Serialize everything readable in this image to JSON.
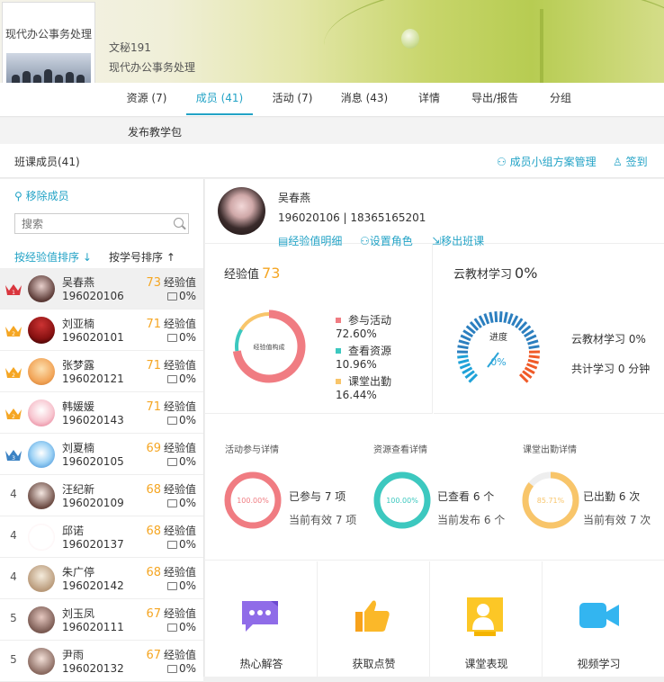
{
  "course": {
    "cover_title": "现代办公事务处理",
    "class_name": "文秘191",
    "course_name": "现代办公事务处理"
  },
  "tabs": [
    {
      "label": "资源 (7)",
      "active": false
    },
    {
      "label": "成员 (41)",
      "active": true
    },
    {
      "label": "活动 (7)",
      "active": false
    },
    {
      "label": "消息 (43)",
      "active": false
    },
    {
      "label": "详情",
      "active": false
    },
    {
      "label": "导出/报告",
      "active": false
    },
    {
      "label": "分组",
      "active": false
    }
  ],
  "subbar": {
    "publish_label": "发布教学包"
  },
  "list_header": {
    "title": "班课成员(41)",
    "group_plan_label": "成员小组方案管理",
    "checkin_label": "签到"
  },
  "left": {
    "remove_label": "移除成员",
    "search_placeholder": "搜索",
    "sort_by_xp_label": "按经验值排序 ↓",
    "sort_by_id_label": "按学号排序 ↑",
    "xp_suffix": "经验值",
    "members": [
      {
        "rank": "1",
        "crown": "red",
        "name": "吴春燕",
        "id": "196020106",
        "xp": "73",
        "pct": "0%",
        "selected": true
      },
      {
        "rank": "2",
        "crown": "orange",
        "name": "刘亚楠",
        "id": "196020101",
        "xp": "71",
        "pct": "0%",
        "selected": false
      },
      {
        "rank": "2",
        "crown": "orange",
        "name": "张梦露",
        "id": "196020121",
        "xp": "71",
        "pct": "0%",
        "selected": false
      },
      {
        "rank": "2",
        "crown": "orange",
        "name": "韩媛媛",
        "id": "196020143",
        "xp": "71",
        "pct": "0%",
        "selected": false
      },
      {
        "rank": "3",
        "crown": "blue",
        "name": "刘夏楠",
        "id": "196020105",
        "xp": "69",
        "pct": "0%",
        "selected": false
      },
      {
        "rank": "4",
        "crown": "",
        "name": "汪纪新",
        "id": "196020109",
        "xp": "68",
        "pct": "0%",
        "selected": false
      },
      {
        "rank": "4",
        "crown": "",
        "name": "邱诺",
        "id": "196020137",
        "xp": "68",
        "pct": "0%",
        "selected": false
      },
      {
        "rank": "4",
        "crown": "",
        "name": "朱广停",
        "id": "196020142",
        "xp": "68",
        "pct": "0%",
        "selected": false
      },
      {
        "rank": "5",
        "crown": "",
        "name": "刘玉凤",
        "id": "196020111",
        "xp": "67",
        "pct": "0%",
        "selected": false
      },
      {
        "rank": "5",
        "crown": "",
        "name": "尹雨",
        "id": "196020132",
        "xp": "67",
        "pct": "0%",
        "selected": false
      }
    ]
  },
  "profile": {
    "name": "吴春燕",
    "id_phone": "196020106 | 18365165201",
    "link_xp_detail": "经验值明细",
    "link_set_role": "设置角色",
    "link_remove": "移出班课"
  },
  "xp_panel": {
    "title": "经验值",
    "value": "73",
    "donut_center": "经验值构成",
    "legend": [
      {
        "label": "参与活动",
        "pct": "72.60%",
        "color": "#f07c82"
      },
      {
        "label": "查看资源",
        "pct": "10.96%",
        "color": "#3cc8bf"
      },
      {
        "label": "课堂出勤",
        "pct": "16.44%",
        "color": "#f8c56a"
      }
    ]
  },
  "cloud_panel": {
    "title": "云教材学习",
    "value": "0%",
    "gauge_label": "进度",
    "gauge_value": "0%",
    "line1": "云教材学习 0%",
    "line2": "共计学习 0 分钟"
  },
  "details": [
    {
      "title": "活动参与详情",
      "ring_text": "100.00%",
      "line1": "已参与 7 项",
      "line2": "当前有效 7 项",
      "color": "#f07c82",
      "fraction": 1.0
    },
    {
      "title": "资源查看详情",
      "ring_text": "100.00%",
      "line1": "已查看 6 个",
      "line2": "当前发布 6 个",
      "color": "#3cc8bf",
      "fraction": 1.0
    },
    {
      "title": "课堂出勤详情",
      "ring_text": "85.71%",
      "line1": "已出勤 6 次",
      "line2": "当前有效 7 次",
      "color": "#f8c56a",
      "fraction": 0.8571
    }
  ],
  "badges": [
    {
      "label": "热心解答",
      "icon": "chat-bubble-icon"
    },
    {
      "label": "获取点赞",
      "icon": "thumbs-up-icon"
    },
    {
      "label": "课堂表现",
      "icon": "presenter-icon"
    },
    {
      "label": "视频学习",
      "icon": "video-camera-icon"
    }
  ]
}
